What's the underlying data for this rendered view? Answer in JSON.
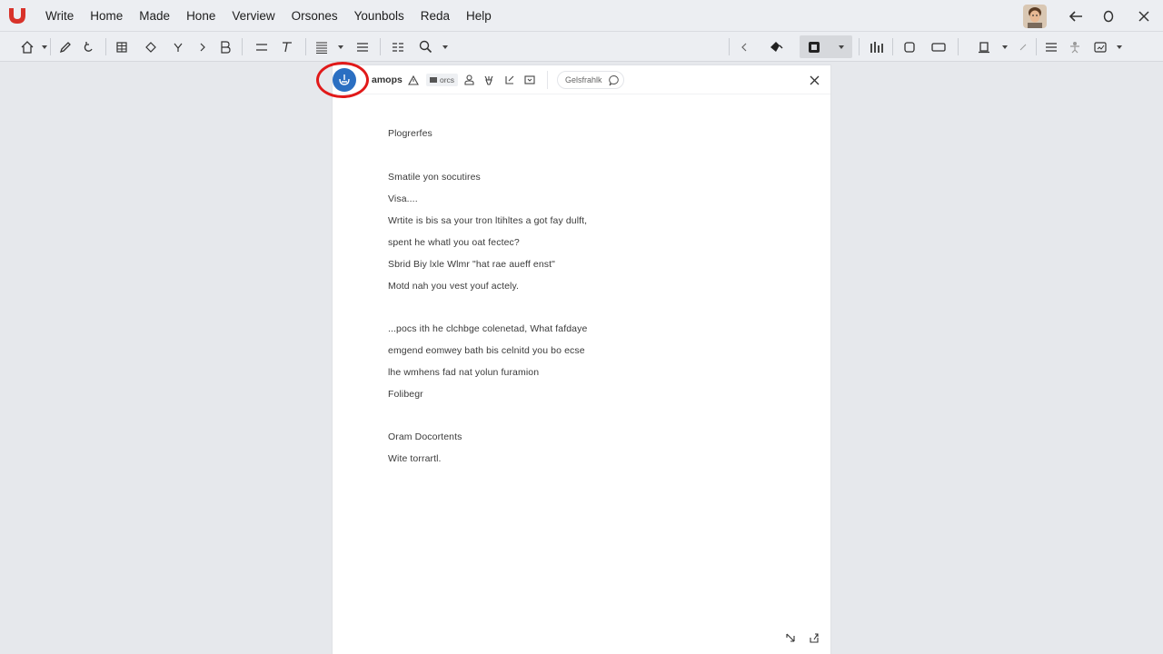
{
  "menubar": {
    "items": [
      "Write",
      "Home",
      "Made",
      "Hone",
      "Verview",
      "Orsones",
      "Younbols",
      "Reda",
      "Help"
    ]
  },
  "icons": {
    "app_logo": "app-logo-icon",
    "avatar": "user-avatar",
    "back": "back-arrow-icon",
    "status": "circle-icon",
    "close": "close-icon"
  },
  "colors": {
    "app_logo": "#d8322a",
    "highlight_ring": "#e11919",
    "primary_icon": "#2b6fc2"
  },
  "doc_toolbar": {
    "label": "amops",
    "chip_label": "orcs",
    "search_placeholder": "Gelsfrahlk"
  },
  "document": {
    "lines": [
      "Plogrerfes",
      "Smatile yon socutires",
      "Visa....",
      "Wrtite is bis sa your tron ltihltes a got fay dulft,",
      "spent he whatl you oat fectec?",
      "Sbrid Biy lxle Wlmr \"hat rae aueff enst\"",
      "Motd nah you vest youf actely.",
      "...pocs ith he clchbge colenetad, What fafdaye",
      "emgend eomwey bath bis celnitd you bo ecse",
      "lhe wmhens fad nat yolun furamion",
      "Folibegr",
      "Oram Docortents",
      "Wite torrartl."
    ]
  }
}
